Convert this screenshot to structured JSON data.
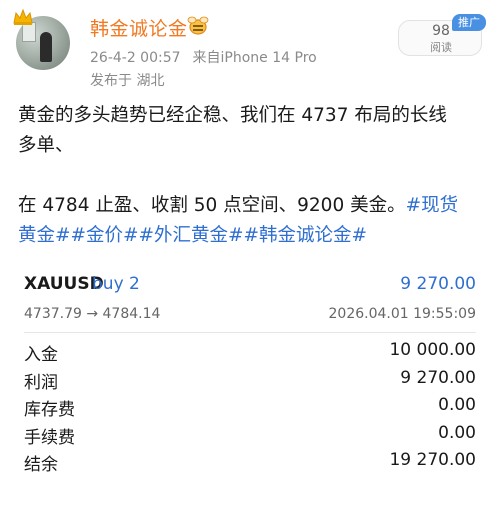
{
  "post": {
    "username": "韩金诚论金",
    "date": "26-4-2 00:57",
    "source": "来自iPhone 14 Pro",
    "location": "发布于 湖北",
    "read_count": "98",
    "read_label": "阅读",
    "badge": "推广",
    "icons": {
      "avatar_crown": "crown-icon",
      "vip": "vip-bee-icon"
    }
  },
  "content": {
    "line1": "黄金的多头趋势已经企稳、我们在 4737 布局的长线",
    "line2": "多单、",
    "line3": "在 4784 止盈、收割 50 点空间、9200 美金。",
    "hashtag1_part1": "#现货",
    "hashtag1_part2": "黄金#",
    "hashtag2": "#金价#",
    "hashtag3": "#外汇黄金#",
    "hashtag4": "#韩金诚论金#"
  },
  "trade": {
    "symbol": "XAUUSD",
    "side": "buy 2",
    "profit": "9 270.00",
    "prices": "4737.79 → 4784.14",
    "time": "2026.04.01 19:55:09"
  },
  "summary": [
    {
      "label": "入金",
      "value": "10 000.00"
    },
    {
      "label": "利润",
      "value": "9 270.00"
    },
    {
      "label": "库存费",
      "value": "0.00"
    },
    {
      "label": "手续费",
      "value": "0.00"
    },
    {
      "label": "结余",
      "value": "19 270.00"
    }
  ],
  "colors": {
    "username": "#f07a24",
    "accent": "#2f6fd0",
    "muted": "#8a8a8a"
  }
}
